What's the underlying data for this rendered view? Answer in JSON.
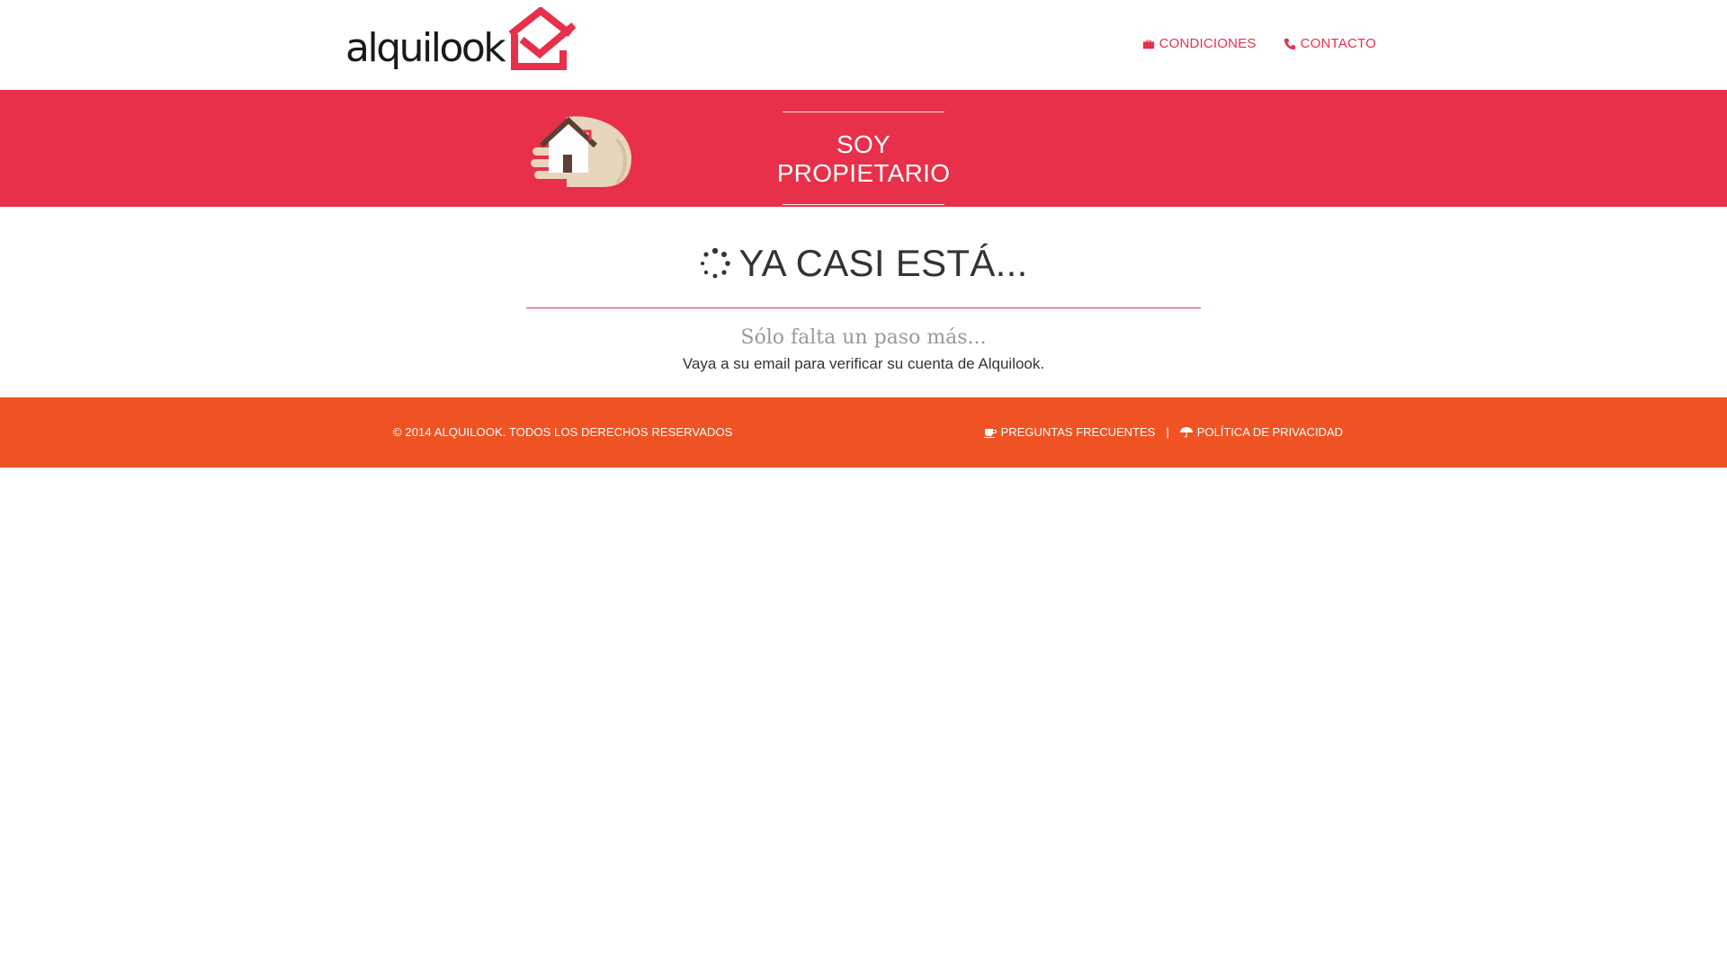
{
  "brand": {
    "name": "alquilook"
  },
  "nav": {
    "items": [
      {
        "label": "CONDICIONES",
        "icon": "briefcase-icon"
      },
      {
        "label": "CONTACTO",
        "icon": "phone-icon"
      }
    ]
  },
  "banner": {
    "title": "SOY PROPIETARIO"
  },
  "main": {
    "heading": "YA CASI ESTÁ...",
    "step": "Sólo falta un paso más...",
    "message": "Vaya a su email para verificar su cuenta de Alquilook."
  },
  "footer": {
    "copyright": "© 2014 ALQUILOOK. TODOS LOS DERECHOS RESERVADOS",
    "separator": "|",
    "links": [
      {
        "label": "PREGUNTAS FRECUENTES",
        "icon": "coffee-icon"
      },
      {
        "label": "POLÍTICA DE PRIVACIDAD",
        "icon": "umbrella-icon"
      }
    ]
  },
  "colors": {
    "accent": "#e8304a",
    "footer": "#f05323",
    "text": "#333333",
    "muted": "#999999"
  }
}
